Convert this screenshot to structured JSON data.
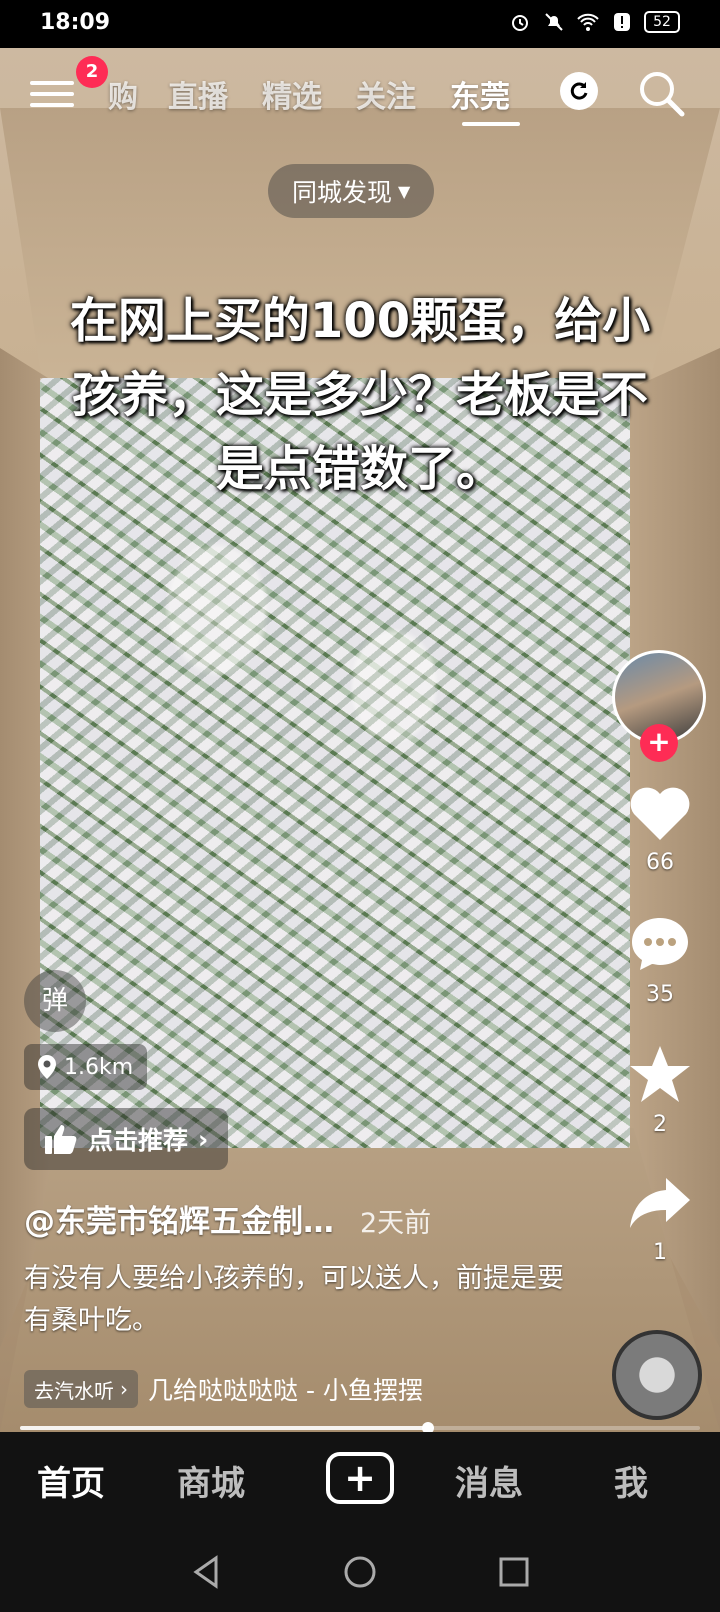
{
  "status_bar": {
    "time": "18:09",
    "battery": "52",
    "icons": [
      "alarm-icon",
      "mute-icon",
      "wifi-icon",
      "alert-icon",
      "battery-icon"
    ]
  },
  "top_nav": {
    "badge_count": "2",
    "tabs": [
      {
        "label": "购"
      },
      {
        "label": "直播"
      },
      {
        "label": "精选"
      },
      {
        "label": "关注"
      },
      {
        "label": "东莞"
      }
    ],
    "active_tab": "东莞"
  },
  "city_pill": {
    "label": "同城发现"
  },
  "video": {
    "caption": "在网上买的100颗蛋，给小孩养，这是多少？老板是不是点错数了。"
  },
  "right_rail": {
    "like_count": "66",
    "comment_count": "35",
    "favorite_count": "2",
    "share_count": "1"
  },
  "overlay": {
    "danmu_label": "弹",
    "distance": "1.6km",
    "recommend_label": "点击推荐",
    "author": "@东莞市铭辉五金制…",
    "time_ago": "2天前",
    "description": "有没有人要给小孩养的，可以送人，前提是要有桑叶吃。",
    "music_chip": "去汽水听",
    "music_title": "几给哒哒哒哒 - 小鱼摆摆",
    "progress": 0.6
  },
  "bottom_nav": {
    "items": [
      {
        "label": "首页"
      },
      {
        "label": "商城"
      },
      {
        "label": "消息"
      },
      {
        "label": "我"
      }
    ]
  }
}
